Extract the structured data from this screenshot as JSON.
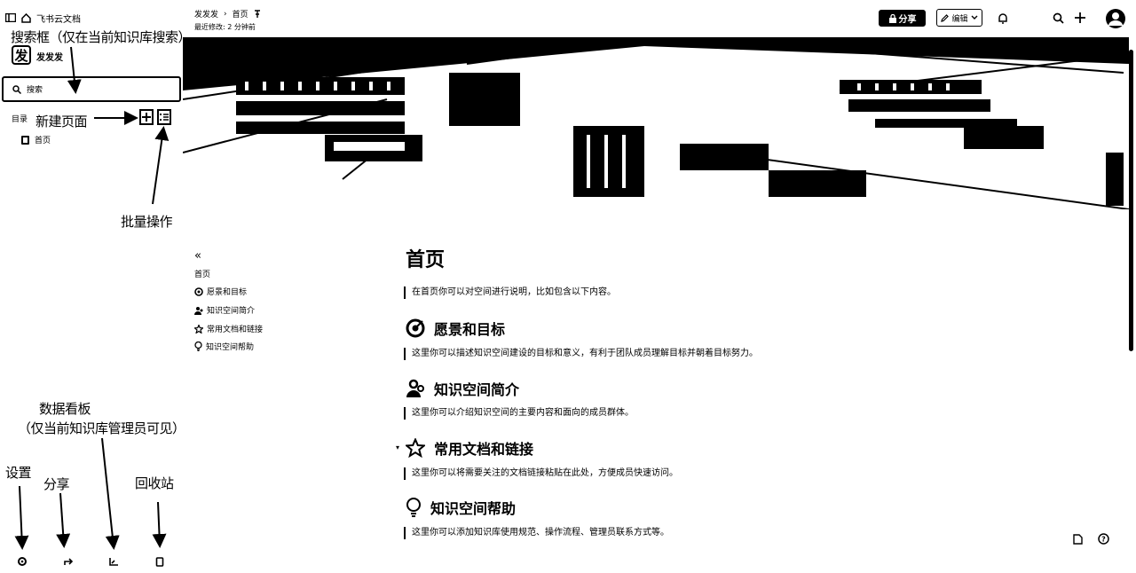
{
  "sidebar": {
    "app_title": "飞书云文档",
    "workspace_avatar": "发",
    "workspace_name": "发发发",
    "search_placeholder": "搜索",
    "tree_label": "目录",
    "pages": [
      {
        "label": "首页"
      }
    ],
    "bottom_icons": [
      "gear-icon",
      "share-icon",
      "dashboard-icon",
      "trash-icon"
    ]
  },
  "annotations": {
    "search": "搜索框（仅在当前知识库搜索）",
    "new_page": "新建页面",
    "batch": "批量操作",
    "dashboard_line1": "数据看板",
    "dashboard_line2": "（仅当前知识库管理员可见）",
    "settings": "设置",
    "share": "分享",
    "recycle": "回收站"
  },
  "header": {
    "breadcrumb": [
      "发发发",
      "首页"
    ],
    "edit_time": "最近修改: 2 分钟前",
    "share_label": "分享",
    "edit_label": "编辑"
  },
  "toc": {
    "items": [
      {
        "label": "首页",
        "icon": ""
      },
      {
        "label": "愿景和目标",
        "icon": "target-icon"
      },
      {
        "label": "知识空间简介",
        "icon": "community-icon"
      },
      {
        "label": "常用文档和链接",
        "icon": "star-icon"
      },
      {
        "label": "知识空间帮助",
        "icon": "bulb-icon"
      }
    ]
  },
  "doc": {
    "title": "首页",
    "intro": "在首页你可以对空间进行说明，比如包含以下内容。",
    "sections": [
      {
        "heading": "愿景和目标",
        "icon": "target-icon",
        "body": "这里你可以描述知识空间建设的目标和意义，有利于团队成员理解目标并朝着目标努力。"
      },
      {
        "heading": "知识空间简介",
        "icon": "community-icon",
        "body": "这里你可以介绍知识空间的主要内容和面向的成员群体。"
      },
      {
        "heading": "常用文档和链接",
        "icon": "star-icon",
        "body": "这里你可以将需要关注的文档链接粘贴在此处，方便成员快速访问。"
      },
      {
        "heading": "知识空间帮助",
        "icon": "bulb-icon",
        "body": "这里你可以添加知识库使用规范、操作流程、管理员联系方式等。"
      }
    ]
  }
}
